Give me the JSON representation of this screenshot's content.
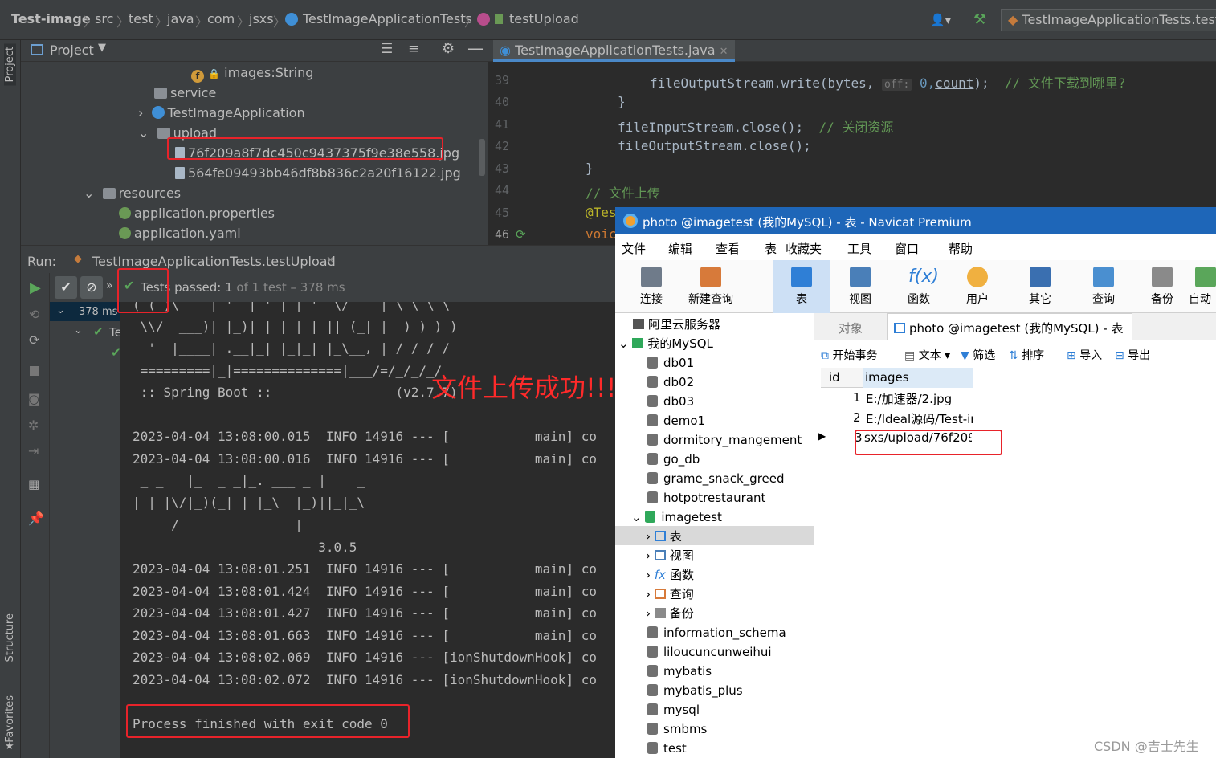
{
  "nav": {
    "project": "Test-image",
    "crumbs": [
      "src",
      "test",
      "java",
      "com",
      "jsxs",
      "TestImageApplicationTests",
      "testUpload"
    ],
    "run_config": "TestImageApplicationTests.testI"
  },
  "left_strip": {
    "project": "Project",
    "structure": "Structure",
    "favorites": "Favorites"
  },
  "project_panel": {
    "title": "Project",
    "tree": [
      {
        "label": "images:String",
        "kind": "field"
      },
      {
        "label": "service",
        "kind": "folder"
      },
      {
        "label": "TestImageApplication",
        "kind": "class"
      },
      {
        "label": "upload",
        "kind": "folder"
      },
      {
        "label": "76f209a8f7dc450c9437375f9e38e558.jpg",
        "kind": "file"
      },
      {
        "label": "564fe09493bb46df8b836c2a20f16122.jpg",
        "kind": "file"
      },
      {
        "label": "resources",
        "kind": "folder"
      },
      {
        "label": "application.properties",
        "kind": "prop"
      },
      {
        "label": "application.yaml",
        "kind": "prop"
      }
    ]
  },
  "editor": {
    "tab": "TestImageApplicationTests.java",
    "lines": [
      "39",
      "40",
      "41",
      "42",
      "43",
      "44",
      "45",
      "46"
    ],
    "code": {
      "l39a": "fileOutputStream.write(bytes,",
      "l39hint": "off:",
      "l39b": "0,",
      "l39c": "count",
      "l39d": ");",
      "l39cm": "// 文件下载到哪里?",
      "l40": "}",
      "l41": "fileInputStream.close();",
      "l41cm": "// 关闭资源",
      "l42": "fileOutputStream.close();",
      "l43": "}",
      "l44cm": "// 文件上传",
      "l45": "@Tes",
      "l46": "voic"
    }
  },
  "run": {
    "label": "Run:",
    "tab": "TestImageApplicationTests.testUpload",
    "status_prefix": "Tests",
    "status_passed": "passed:",
    "status_count": "1",
    "status_rest": "of 1 test – 378 ms",
    "tree_time": "378 ms",
    "tree_child": "Te",
    "console": [
      "( ( )\\___ | '_ | '_| | '_ \\/ _` | \\ \\ \\ \\",
      " \\\\/  ___)| |_)| | | | | || (_| |  ) ) ) )",
      "  '  |____| .__|_| |_|_| |_\\__, | / / / /",
      " =========|_|==============|___/=/_/_/_/",
      " :: Spring Boot ::                (v2.7.7)",
      "",
      "2023-04-04 13:08:00.015  INFO 14916 --- [           main] co",
      "2023-04-04 13:08:00.016  INFO 14916 --- [           main] co",
      " _ _   |_  _ _|_. ___ _ |    _",
      "| | |\\/|_)(_| | |_\\  |_)||_|_\\",
      "     /               |",
      "                        3.0.5",
      "2023-04-04 13:08:01.251  INFO 14916 --- [           main] co",
      "2023-04-04 13:08:01.424  INFO 14916 --- [           main] co",
      "2023-04-04 13:08:01.427  INFO 14916 --- [           main] co",
      "2023-04-04 13:08:01.663  INFO 14916 --- [           main] co",
      "2023-04-04 13:08:02.069  INFO 14916 --- [ionShutdownHook] co",
      "2023-04-04 13:08:02.072  INFO 14916 --- [ionShutdownHook] co",
      "",
      "Process finished with exit code 0"
    ]
  },
  "overlay_text": "文件上传成功!!!!",
  "navicat": {
    "title": "photo @imagetest (我的MySQL) - 表 - Navicat Premium",
    "menu": [
      "文件",
      "编辑",
      "查看",
      "表",
      "收藏夹",
      "工具",
      "窗口",
      "帮助"
    ],
    "toolbar": [
      "连接",
      "新建查询",
      "表",
      "视图",
      "函数",
      "用户",
      "其它",
      "查询",
      "备份",
      "自动"
    ],
    "tree": {
      "aliyun": "阿里云服务器",
      "mysql": "我的MySQL",
      "dbs_before": [
        "db01",
        "db02",
        "db03",
        "demo1",
        "dormitory_mangement",
        "go_db",
        "grame_snack_greed",
        "hotpotrestaurant"
      ],
      "imagetest": "imagetest",
      "sub": [
        "表",
        "视图",
        "函数",
        "查询",
        "备份"
      ],
      "dbs_after": [
        "information_schema",
        "liloucuncunweihui",
        "mybatis",
        "mybatis_plus",
        "mysql",
        "smbms",
        "test"
      ]
    },
    "object_tabs": {
      "objects": "对象",
      "table_tab": "photo @imagetest (我的MySQL) - 表"
    },
    "table_toolbar": [
      "开始事务",
      "文本",
      "筛选",
      "排序",
      "导入",
      "导出"
    ],
    "grid": {
      "headers": [
        "id",
        "images"
      ],
      "rows": [
        {
          "id": "1",
          "images": "E:/加速器/2.jpg"
        },
        {
          "id": "2",
          "images": "E:/Ideal源码/Test-ir"
        },
        {
          "id": "3",
          "images": "sxs/upload/76f209"
        }
      ]
    }
  },
  "watermark": "CSDN @吉士先生",
  "colors": {
    "accent": "#4a88c7",
    "annotation": "#e8232a",
    "pass": "#5aa65a",
    "navicat_title": "#1e66b8"
  }
}
